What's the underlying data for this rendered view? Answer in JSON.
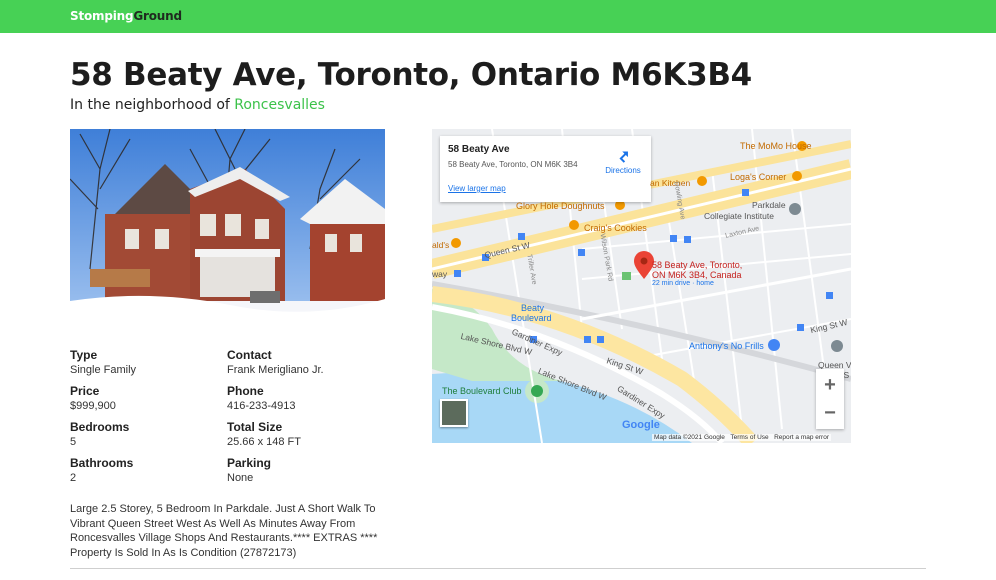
{
  "brand": {
    "part1": "Stomping",
    "part2": "Ground"
  },
  "listing": {
    "title": "58 Beaty Ave, Toronto, Ontario M6K3B4",
    "neighborhood_prefix": "In the neighborhood of",
    "neighborhood": "Roncesvalles",
    "facts": {
      "type_label": "Type",
      "type_value": "Single Family",
      "contact_label": "Contact",
      "contact_value": "Frank Merigliano Jr.",
      "price_label": "Price",
      "price_value": "$999,900",
      "phone_label": "Phone",
      "phone_value": "416-233-4913",
      "bedrooms_label": "Bedrooms",
      "bedrooms_value": "5",
      "size_label": "Total Size",
      "size_value": "25.66 x 148 FT",
      "bathrooms_label": "Bathrooms",
      "bathrooms_value": "2",
      "parking_label": "Parking",
      "parking_value": "None"
    },
    "description": "Large 2.5 Storey, 5 Bedroom In Parkdale. Just A Short Walk To Vibrant Queen Street West As Well As Minutes Away From Roncesvalles Village Shops And Restaurants.**** EXTRAS **** Property Is Sold In As Is Condition (27872173)"
  },
  "map": {
    "card_name": "58 Beaty Ave",
    "card_address": "58 Beaty Ave, Toronto, ON M6K 3B4",
    "directions": "Directions",
    "larger_map": "View larger map",
    "pin_line1": "58 Beaty Ave, Toronto,",
    "pin_line2": "ON M6K 3B4, Canada",
    "pin_drive": "22 min drive · home",
    "labels": {
      "momo": "The MoMo House",
      "logas": "Loga's Corner",
      "kitchen": "an Kitchen",
      "gloryhole": "Glory Hole Doughnuts",
      "craigs": "Craig's Cookies",
      "parkdale1": "Parkdale",
      "parkdale2": "Collegiate Institute",
      "queenst": "Queen St W",
      "beaty1": "Beaty",
      "beaty2": "Boulevard",
      "lakeshore1": "Lake Shore Blvd W",
      "lakeshore2": "Lake Shore Blvd W",
      "gardiner1": "Gardiner Expy",
      "gardiner2": "Gardiner Expy",
      "kingst": "King St W",
      "kingst2": "King St W",
      "anthonys": "Anthony's No Frills",
      "queenvic1": "Queen Victoria",
      "queenvic2": "Public S",
      "boulevardclub": "The Boulevard Club",
      "laxton": "Laxton Ave",
      "dowling": "Dowling Ave",
      "wilson": "Wilson Park Rd",
      "triller": "Triller Ave",
      "alds": "ald's",
      "way": "way"
    },
    "zoom_in": "+",
    "zoom_out": "−",
    "google": "Google",
    "map_data": "Map data ©2021 Google",
    "terms": "Terms of Use",
    "report": "Report a map error",
    "colors": {
      "land": "#eceef1",
      "water": "#a8d8f6",
      "highway": "#fde6a1",
      "park": "#c5e8c8",
      "pin": "#ea4335",
      "accent": "#47d155"
    }
  }
}
